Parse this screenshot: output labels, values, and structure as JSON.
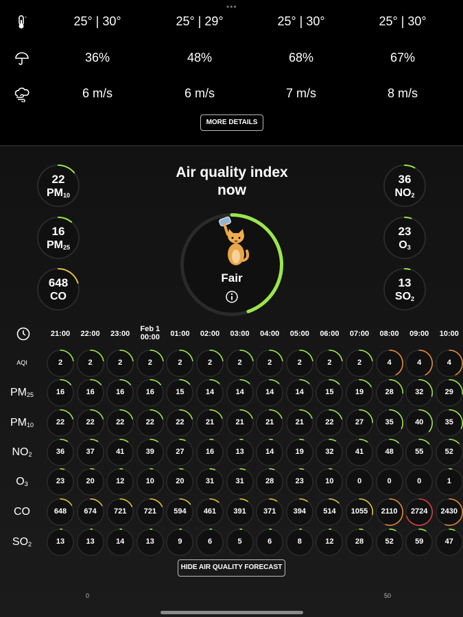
{
  "weather": {
    "temperature": [
      "25° | 30°",
      "25° | 29°",
      "25° | 30°",
      "25° | 30°"
    ],
    "precipitation": [
      "36%",
      "48%",
      "68%",
      "67%"
    ],
    "wind": [
      "6 m/s",
      "6 m/s",
      "7 m/s",
      "8 m/s"
    ],
    "more_details_label": "MORE DETAILS"
  },
  "air_quality": {
    "title_line1": "Air quality index",
    "title_line2": "now",
    "status": "Fair",
    "status_level": 0.62,
    "colors": {
      "good": "#9be64b",
      "moderate": "#e2c23c",
      "orange": "#e38a3a",
      "red": "#d8413a",
      "track": "#2a2a2a"
    },
    "left": [
      {
        "value": "22",
        "name": "PM",
        "sub": "10"
      },
      {
        "value": "16",
        "name": "PM",
        "sub": "25"
      },
      {
        "value": "648",
        "name": "CO",
        "sub": ""
      }
    ],
    "right": [
      {
        "value": "36",
        "name": "NO",
        "sub": "2"
      },
      {
        "value": "23",
        "name": "O",
        "sub": "3"
      },
      {
        "value": "13",
        "name": "SO",
        "sub": "2"
      }
    ]
  },
  "forecast": {
    "times": [
      "21:00",
      "22:00",
      "23:00",
      "Feb 1\n00:00",
      "01:00",
      "02:00",
      "03:00",
      "04:00",
      "05:00",
      "06:00",
      "07:00",
      "08:00",
      "09:00",
      "10:00"
    ],
    "rows": [
      {
        "label": "AQI",
        "sub": "",
        "values": [
          "2",
          "2",
          "2",
          "2",
          "2",
          "2",
          "2",
          "2",
          "2",
          "2",
          "2",
          "4",
          "4",
          "4"
        ]
      },
      {
        "label": "PM",
        "sub": "25",
        "values": [
          "16",
          "16",
          "16",
          "16",
          "15",
          "14",
          "14",
          "14",
          "14",
          "15",
          "19",
          "28",
          "32",
          "29"
        ]
      },
      {
        "label": "PM",
        "sub": "10",
        "values": [
          "22",
          "22",
          "22",
          "22",
          "22",
          "21",
          "21",
          "21",
          "21",
          "22",
          "27",
          "35",
          "40",
          "35"
        ]
      },
      {
        "label": "NO",
        "sub": "2",
        "values": [
          "36",
          "37",
          "41",
          "39",
          "27",
          "16",
          "13",
          "14",
          "19",
          "32",
          "41",
          "48",
          "55",
          "52"
        ]
      },
      {
        "label": "O",
        "sub": "3",
        "values": [
          "23",
          "20",
          "12",
          "10",
          "20",
          "31",
          "31",
          "28",
          "23",
          "10",
          "0",
          "0",
          "0",
          "1"
        ]
      },
      {
        "label": "CO",
        "sub": "",
        "values": [
          "648",
          "674",
          "721",
          "721",
          "594",
          "461",
          "391",
          "371",
          "394",
          "514",
          "1055",
          "2110",
          "2724",
          "2430"
        ]
      },
      {
        "label": "SO",
        "sub": "2",
        "values": [
          "13",
          "13",
          "14",
          "13",
          "9",
          "6",
          "5",
          "6",
          "8",
          "12",
          "28",
          "52",
          "59",
          "47"
        ]
      }
    ],
    "hide_label": "HIDE AIR QUALITY FORECAST"
  },
  "footer": {
    "left_tick": "0",
    "right_tick": "50"
  },
  "icons": {
    "temperature": "thermometer-icon",
    "precipitation": "umbrella-icon",
    "wind": "wind-cloud-icon",
    "clock": "clock-icon",
    "info": "info-icon"
  }
}
